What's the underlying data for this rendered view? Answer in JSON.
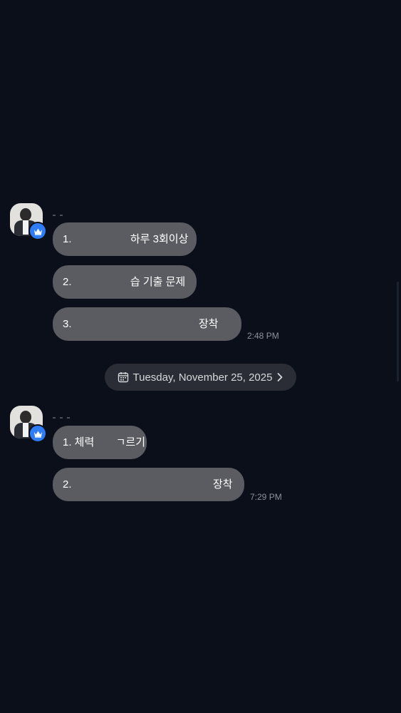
{
  "colors": {
    "background": "#0b0f1a",
    "bubble": "#5a5c62",
    "date_pill": "#2a2d35",
    "badge": "#2f7df6",
    "timestamp": "#8d919a"
  },
  "groups": [
    {
      "avatar_icon": "profile-photo",
      "badge_icon": "crown-icon",
      "messages": [
        {
          "prefix": "1.",
          "suffix": "하루 3회이상"
        },
        {
          "prefix": "2.",
          "suffix": "습 기출 문제"
        },
        {
          "prefix": "3.",
          "suffix": "장착"
        }
      ],
      "time": "2:48 PM"
    },
    {
      "avatar_icon": "profile-photo",
      "badge_icon": "crown-icon",
      "messages": [
        {
          "prefix": "1. 체력",
          "suffix": "ㄱ르기"
        },
        {
          "prefix": "2.",
          "suffix": "장착"
        }
      ],
      "time": "7:29 PM"
    }
  ],
  "date_separator": {
    "icon": "calendar-icon",
    "label": "Tuesday, November 25, 2025",
    "chevron": "chevron-right-icon"
  }
}
